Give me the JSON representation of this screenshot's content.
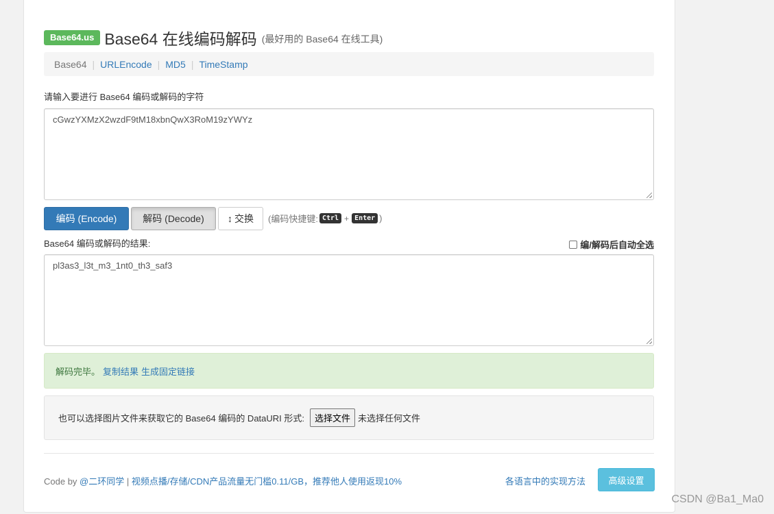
{
  "header": {
    "badge": "Base64.us",
    "title": "Base64 在线编码解码",
    "subtitle": "(最好用的 Base64 在线工具)"
  },
  "nav": {
    "items": [
      {
        "label": "Base64",
        "active": true
      },
      {
        "label": "URLEncode",
        "active": false
      },
      {
        "label": "MD5",
        "active": false
      },
      {
        "label": "TimeStamp",
        "active": false
      }
    ],
    "separator": "|"
  },
  "input": {
    "label": "请输入要进行 Base64 编码或解码的字符",
    "value": "cGwzYXMzX2wzdF9tM18xbnQwX3RoM19zYWYz"
  },
  "buttons": {
    "encode": "编码 (Encode)",
    "decode": "解码 (Decode)",
    "swap": "交换",
    "swap_icon": "↕"
  },
  "shortcut": {
    "prefix": "(编码快捷键:",
    "key1": "Ctrl",
    "plus": "+",
    "key2": "Enter",
    "suffix": ")"
  },
  "output": {
    "label": "Base64 编码或解码的结果:",
    "value": "pl3as3_l3t_m3_1nt0_th3_saf3",
    "autoselect_label": "编/解码后自动全选",
    "autoselect_checked": false
  },
  "alert": {
    "message": "解码完毕。",
    "copy_link": "复制结果",
    "permalink": "生成固定链接"
  },
  "file": {
    "label": "也可以选择图片文件来获取它的 Base64 编码的 DataURI 形式:",
    "button": "选择文件",
    "status": "未选择任何文件"
  },
  "footer": {
    "code_by": "Code by",
    "author": "@二环同学",
    "sep": "|",
    "promo": "视频点播/存储/CDN产品流量无门槛0.11/GB，推荐他人使用返现10%",
    "impl_link": "各语言中的实现方法",
    "advanced": "高级设置"
  },
  "watermark": "CSDN @Ba1_Ma0",
  "colors": {
    "badge": "#5cb85c",
    "primary": "#337ab7",
    "alert_bg": "#dff0d8",
    "info": "#5bc0de"
  }
}
